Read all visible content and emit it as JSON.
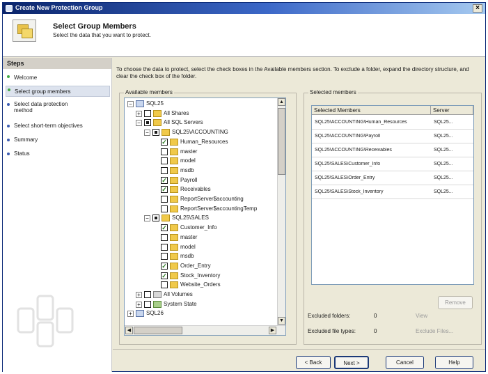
{
  "window": {
    "title": "Create New Protection Group",
    "close_glyph": "×"
  },
  "header": {
    "title": "Select Group Members",
    "subtitle": "Select the data that you want to protect."
  },
  "sidebar": {
    "heading": "Steps",
    "steps": [
      {
        "label": "Welcome",
        "state": "done"
      },
      {
        "label": "Select group members",
        "state": "current"
      },
      {
        "label": "Select data protection method",
        "state": "pending"
      },
      {
        "label": "Select short-term objectives",
        "state": "pending"
      },
      {
        "label": "Summary",
        "state": "pending"
      },
      {
        "label": "Status",
        "state": "pending"
      }
    ]
  },
  "instructions": "To choose the data to protect, select the check boxes in the Available members section. To exclude a folder, expand the directory structure, and clear the check box of the folder.",
  "available": {
    "label": "Available members",
    "tree": [
      {
        "label": "SQL25",
        "toggle": "−",
        "check": "none",
        "icon": "server-icon"
      },
      {
        "label": "All Shares",
        "toggle": "+",
        "check": "unchecked",
        "icon": "shares-folder-icon"
      },
      {
        "label": "All SQL Servers",
        "toggle": "−",
        "check": "partial",
        "icon": "sql-servers-icon"
      },
      {
        "label": "SQL25\\ACCOUNTING",
        "toggle": "−",
        "check": "partial",
        "icon": "sql-instance-icon"
      },
      {
        "label": "Human_Resources",
        "toggle": "",
        "check": "checked",
        "icon": "database-icon"
      },
      {
        "label": "master",
        "toggle": "",
        "check": "unchecked",
        "icon": "database-icon"
      },
      {
        "label": "model",
        "toggle": "",
        "check": "unchecked",
        "icon": "database-icon"
      },
      {
        "label": "msdb",
        "toggle": "",
        "check": "unchecked",
        "icon": "database-icon"
      },
      {
        "label": "Payroll",
        "toggle": "",
        "check": "checked",
        "icon": "database-icon"
      },
      {
        "label": "Receivables",
        "toggle": "",
        "check": "checked",
        "icon": "database-icon"
      },
      {
        "label": "ReportServer$accounting",
        "toggle": "",
        "check": "unchecked",
        "icon": "database-icon"
      },
      {
        "label": "ReportServer$accountingTemp",
        "toggle": "",
        "check": "unchecked",
        "icon": "database-icon"
      },
      {
        "label": "SQL25\\SALES",
        "toggle": "−",
        "check": "partial",
        "icon": "sql-instance-icon"
      },
      {
        "label": "Customer_Info",
        "toggle": "",
        "check": "checked",
        "icon": "database-icon"
      },
      {
        "label": "master",
        "toggle": "",
        "check": "unchecked",
        "icon": "database-icon"
      },
      {
        "label": "model",
        "toggle": "",
        "check": "unchecked",
        "icon": "database-icon"
      },
      {
        "label": "msdb",
        "toggle": "",
        "check": "unchecked",
        "icon": "database-icon"
      },
      {
        "label": "Order_Entry",
        "toggle": "",
        "check": "checked",
        "icon": "database-icon"
      },
      {
        "label": "Stock_Inventory",
        "toggle": "",
        "check": "checked",
        "icon": "database-icon"
      },
      {
        "label": "Website_Orders",
        "toggle": "",
        "check": "unchecked",
        "icon": "database-icon"
      },
      {
        "label": "All Volumes",
        "toggle": "+",
        "check": "unchecked",
        "icon": "volumes-icon"
      },
      {
        "label": "System State",
        "toggle": "+",
        "check": "unchecked",
        "icon": "system-state-icon"
      },
      {
        "label": "SQL26",
        "toggle": "+",
        "check": "none",
        "icon": "server-icon"
      }
    ]
  },
  "selected": {
    "label": "Selected members",
    "columns": [
      "Selected Members",
      "Server"
    ],
    "rows": [
      [
        "SQL25\\ACCOUNTING\\Human_Resources",
        "SQL25..."
      ],
      [
        "SQL25\\ACCOUNTING\\Payroll",
        "SQL25..."
      ],
      [
        "SQL25\\ACCOUNTING\\Receivables",
        "SQL25..."
      ],
      [
        "SQL25\\SALES\\Customer_Info",
        "SQL25..."
      ],
      [
        "SQL25\\SALES\\Order_Entry",
        "SQL25..."
      ],
      [
        "SQL25\\SALES\\Stock_Inventory",
        "SQL25..."
      ]
    ],
    "remove_label": "Remove",
    "excluded_folders_label": "Excluded folders:",
    "excluded_folders_value": "0",
    "view_label": "View",
    "excluded_types_label": "Excluded file types:",
    "excluded_types_value": "0",
    "exclude_files_label": "Exclude Files..."
  },
  "buttons": {
    "back": "< Back",
    "next": "Next >",
    "cancel": "Cancel",
    "help": "Help"
  }
}
